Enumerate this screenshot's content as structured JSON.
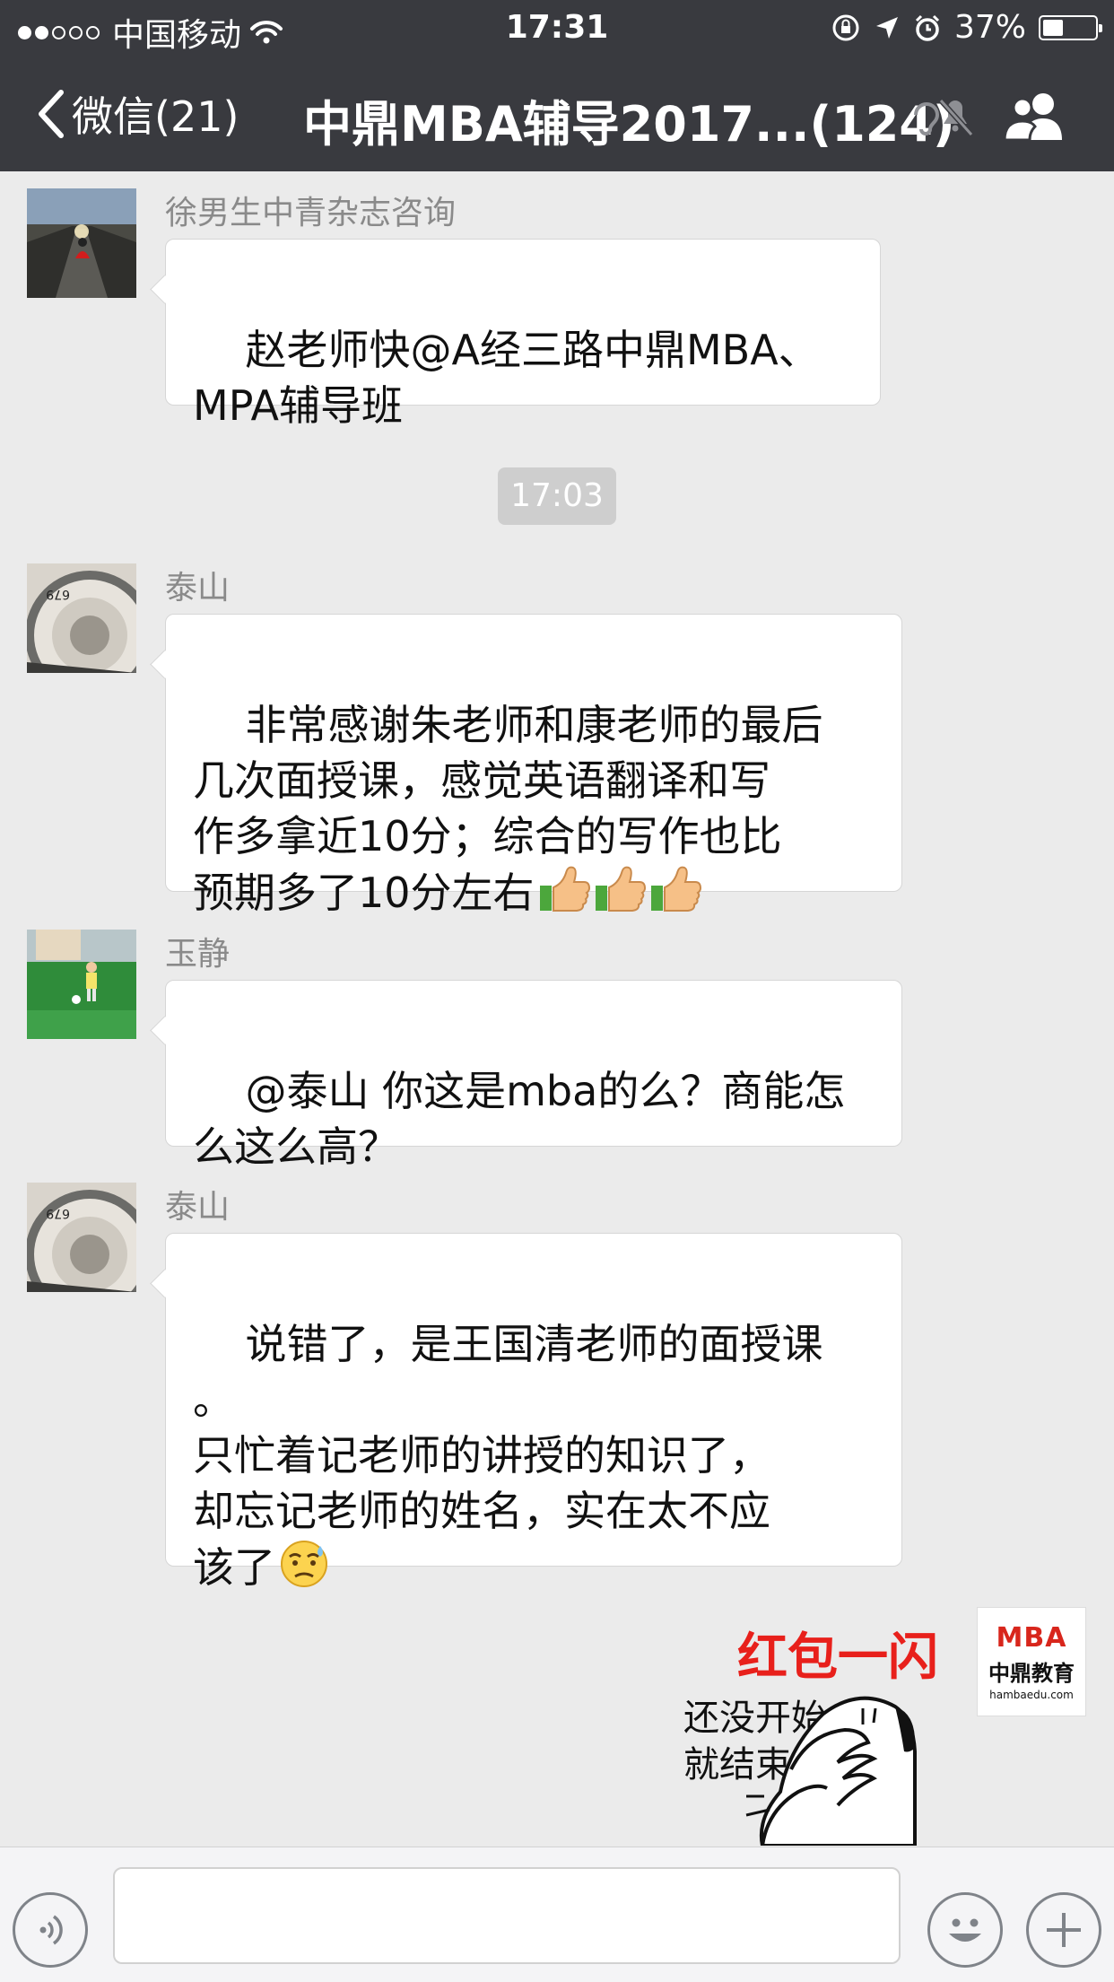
{
  "status_bar": {
    "carrier": "中国移动",
    "time": "17:31",
    "battery": "37%"
  },
  "nav": {
    "back_label": "微信(21)",
    "title": "中鼎MBA辅导2017...(124)"
  },
  "messages": [
    {
      "sender": "徐男生中青杂志咨询",
      "text": "赵老师快@A经三路中鼎MBA、\nMPA辅导班"
    },
    {
      "sender": "泰山",
      "text": "非常感谢朱老师和康老师的最后\n几次面授课，感觉英语翻译和写\n作多拿近10分；综合的写作也比\n预期多了10分左右"
    },
    {
      "sender": "玉静",
      "text": "@泰山 你这是mba的么？商能怎\n么这么高？"
    },
    {
      "sender": "泰山",
      "text": "说错了，是王国清老师的面授课\n。\n只忙着记老师的讲授的知识了，\n却忘记老师的姓名，实在太不应\n该了"
    }
  ],
  "timestamp": "17:03",
  "sticker": {
    "title": "红包一闪",
    "line1": "还没开始",
    "line2": "就结束了"
  },
  "mba_avatar": {
    "logo": "MBA",
    "name": "中鼎教育",
    "url": "hambaedu.com"
  },
  "colors": {
    "header_bg": "#393a3f",
    "chat_bg": "#ebebeb",
    "sticker_red": "#e8201b"
  },
  "icons": [
    "chevron-left-icon",
    "mute-icon",
    "group-members-icon",
    "voice-icon",
    "emoji-icon",
    "plus-icon",
    "thumbs-up-icon",
    "sweat-emoji-icon"
  ]
}
